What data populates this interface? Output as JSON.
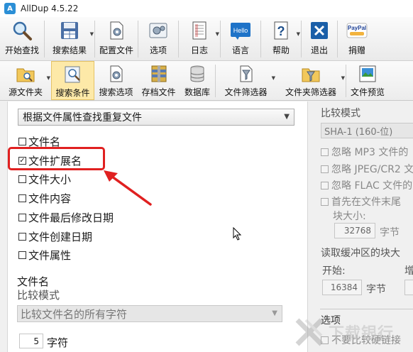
{
  "window": {
    "title": "AllDup 4.5.22"
  },
  "toolbar_main": [
    {
      "label": "开始查找",
      "icon": "magnifier-icon"
    },
    {
      "label": "搜索结果",
      "icon": "floppy-table-icon",
      "dropdown": true
    },
    {
      "label": "配置文件",
      "icon": "config-file-icon"
    },
    {
      "label": "选项",
      "icon": "options-gear-icon"
    },
    {
      "label": "日志",
      "icon": "log-icon",
      "dropdown": true
    },
    {
      "label": "语言",
      "icon": "hello-language-icon"
    },
    {
      "label": "帮助",
      "icon": "help-question-icon",
      "dropdown": true
    },
    {
      "label": "退出",
      "icon": "exit-x-icon"
    },
    {
      "label": "捐赠",
      "icon": "paypal-donate-icon"
    }
  ],
  "toolbar_tabs": [
    {
      "label": "源文件夹",
      "icon": "source-folder-icon",
      "dropdown": true
    },
    {
      "label": "搜索条件",
      "icon": "search-criteria-icon",
      "active": true
    },
    {
      "label": "搜索选项",
      "icon": "search-options-icon"
    },
    {
      "label": "存档文件",
      "icon": "archive-icon"
    },
    {
      "label": "数据库",
      "icon": "database-icon"
    },
    {
      "label": "文件筛选器",
      "icon": "file-filter-icon",
      "dropdown": true
    },
    {
      "label": "文件夹筛选器",
      "icon": "folder-filter-icon",
      "dropdown": true
    },
    {
      "label": "文件预览",
      "icon": "file-preview-icon"
    }
  ],
  "criteria": {
    "mode_select": "根据文件属性查找重复文件",
    "checkboxes": [
      {
        "label": "文件名",
        "checked": false
      },
      {
        "label": "文件扩展名",
        "checked": true
      },
      {
        "label": "文件大小",
        "checked": false
      },
      {
        "label": "文件内容",
        "checked": false
      },
      {
        "label": "文件最后修改日期",
        "checked": false
      },
      {
        "label": "文件创建日期",
        "checked": false
      },
      {
        "label": "文件属性",
        "checked": false
      }
    ],
    "filename_section": "文件名",
    "compare_mode_label": "比较模式",
    "compare_mode_value": "比较文件名的所有字符",
    "chars_value": "5",
    "chars_unit": "字符"
  },
  "right_panel": {
    "compare_mode_label": "比较模式",
    "hash_select": "SHA-1 (160-位)",
    "ignore_mp3": "忽略 MP3 文件的",
    "ignore_jpeg": "忽略 JPEG/CR2 文",
    "ignore_flac": "忽略 FLAC 文件的",
    "compare_end_first": "首先在文件末尾",
    "block_size_label": "块大小:",
    "block_size_value": "32768",
    "block_size_unit": "字节",
    "read_buffer_label": "读取缓冲区的块大",
    "start_label": "开始:",
    "start_value": "16384",
    "start_unit": "字节",
    "increase_label": "增",
    "options_label": "选项",
    "no_compare_hardlinks": "不要比较硬链接"
  },
  "watermark": {
    "text": "下载银行"
  },
  "colors": {
    "highlight": "#e02020",
    "active_tab": "#fde9a8",
    "checked": "#1a1a1a"
  }
}
